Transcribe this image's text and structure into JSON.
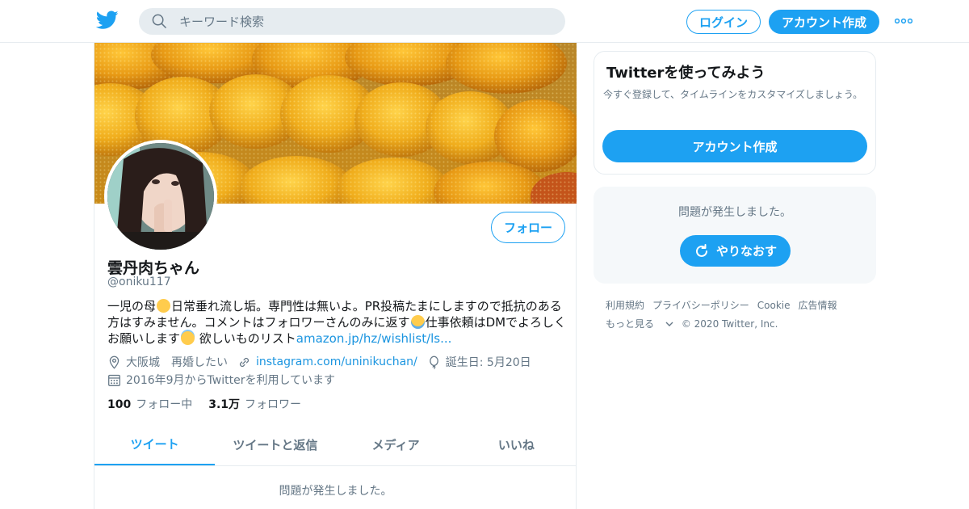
{
  "header": {
    "search_placeholder": "キーワード検索",
    "login_label": "ログイン",
    "signup_label": "アカウント作成",
    "icons": [
      "twitter-bird-icon",
      "search-icon",
      "more-dots-icon"
    ]
  },
  "profile": {
    "display_name": "雲丹肉ちゃん",
    "handle": "@oniku117",
    "follow_label": "フォロー",
    "bio": {
      "part1": "一児の母",
      "part2": "日常垂れ流し垢。専門性は無いよ。PR投稿たまにしますので抵抗のある方はすみません。コメントはフォロワーさんのみに返す",
      "part3": "仕事依頼はDMでよろしくお願いします",
      "part4": " 欲しいものリスト",
      "link": "amazon.jp/hz/wishlist/ls..."
    },
    "location": "大阪城　再婚したい",
    "website": "instagram.com/uninikuchan/",
    "birthday": "誕生日: 5月20日",
    "joined": "2016年9月からTwitterを利用しています",
    "following_count": "100",
    "following_label": "フォロー中",
    "followers_count": "3.1万",
    "followers_label": "フォロワー",
    "tabs": [
      {
        "label": "ツイート",
        "active": true
      },
      {
        "label": "ツイートと返信",
        "active": false
      },
      {
        "label": "メディア",
        "active": false
      },
      {
        "label": "いいね",
        "active": false
      }
    ],
    "error_message": "問題が発生しました。"
  },
  "sidebar": {
    "promo_title": "Twitterを使ってみよう",
    "promo_desc": "今すぐ登録して、タイムラインをカスタマイズしましょう。",
    "promo_button": "アカウント作成",
    "error_message": "問題が発生しました。",
    "retry_label": "やりなおす"
  },
  "footer": {
    "links": [
      "利用規約",
      "プライバシーポリシー",
      "Cookie",
      "広告情報"
    ],
    "more_label": "もっと見る",
    "copyright": "© 2020 Twitter, Inc."
  },
  "colors": {
    "accent": "#1da1f2",
    "link": "#1b95e0",
    "muted": "#657786",
    "border": "#e6ecf0"
  }
}
